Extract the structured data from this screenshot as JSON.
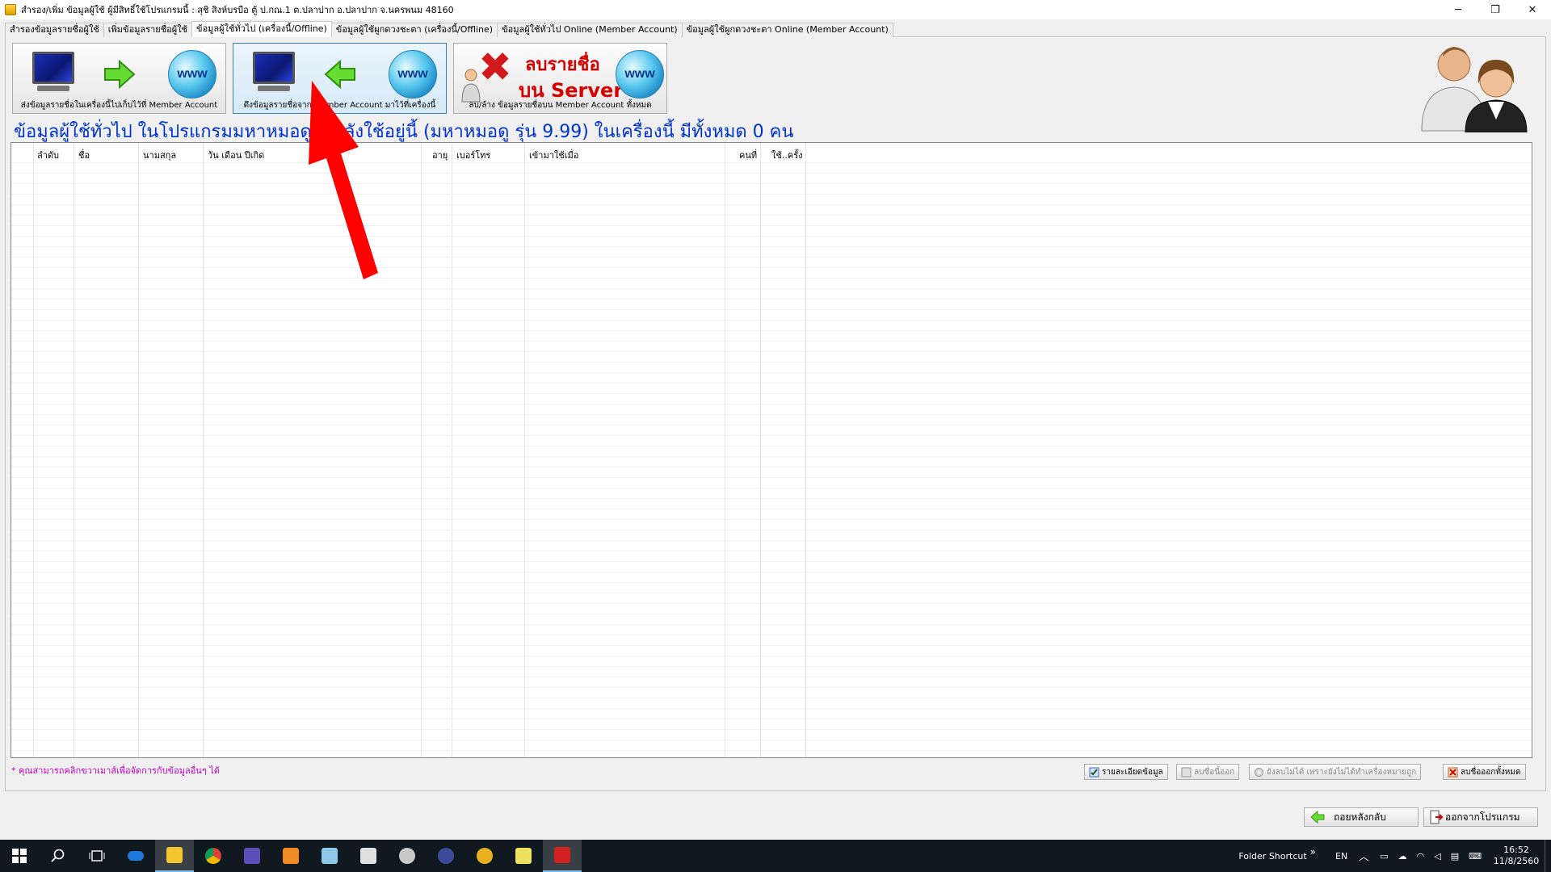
{
  "window": {
    "title": "สำรอง/เพิ่ม ข้อมูลผู้ใช้ ผู้มีสิทธิ์ใช้โปรแกรมนี้ : สุชิ  สิงห์บรบือ    ตู้ ป.กณ.1 ต.ปลาปาก อ.ปลาปาก จ.นครพนม 48160",
    "minimize": "─",
    "restore": "❐",
    "close": "✕"
  },
  "tabs": [
    {
      "label": "สำรองข้อมูลรายชื่อผู้ใช้"
    },
    {
      "label": "เพิ่มข้อมูลรายชื่อผู้ใช้"
    },
    {
      "label": "ข้อมูลผู้ใช้ทั่วไป (เครื่องนี้/Offline)"
    },
    {
      "label": "ข้อมูลผู้ใช้ผูกดวงชะตา (เครื่องนี้/Offline)"
    },
    {
      "label": "ข้อมูลผู้ใช้ทั่วไป Online (Member Account)"
    },
    {
      "label": "ข้อมูลผู้ใช้ผูกดวงชะตา Online (Member Account)"
    }
  ],
  "active_tab": 2,
  "actions": {
    "send": {
      "caption": "ส่งข้อมูลรายชื่อในเครื่องนี้ไปเก็บไว้ที่ Member Account"
    },
    "fetch": {
      "caption": "ดึงข้อมูลรายชื่อจาก Member Account มาไว้ที่เครื่องนี้"
    },
    "delete": {
      "caption": "ลบ/ล้าง ข้อมูลรายชื่อบน Member Account ทั้งหมด",
      "line1": "ลบรายชื่อ",
      "line2": "บน Server"
    },
    "www": "www"
  },
  "heading": "ข้อมูลผู้ใช้ทั่วไป ในโปรแกรมมหาหมอดูที่กำลังใช้อยู่นี้ (มหาหมอดู รุ่น 9.99) ในเครื่องนี้ มีทั้งหมด 0 คน",
  "grid": {
    "columns": [
      "ลำดับ",
      "ชื่อ",
      "นามสกุล",
      "วัน เดือน ปีเกิด",
      "อายุ",
      "เบอร์โทร",
      "เข้ามาใช้เมื่อ",
      "คนที่",
      "ใช้..ครั้ง"
    ],
    "rows": []
  },
  "note": "* คุณสามารถคลิกขวาเมาส์เพื่อจัดการกับข้อมูลอื่นๆ ได้",
  "small_buttons": {
    "details": "รายละเอียดข้อมูล",
    "delete_one": "ลบชื่อนี้ออก",
    "cannot_delete": "ยังลบไม่ได้ เพราะยังไม่ได้ทำเครื่องหมายถูก",
    "delete_all": "ลบชื่อออกทั้งหมด"
  },
  "bottom_buttons": {
    "back": "ถอยหลังกลับ",
    "exit": "ออกจากโปรแกรม"
  },
  "taskbar": {
    "folder_shortcut": "Folder Shortcut",
    "chevron": "»",
    "lang": "EN",
    "time": "16:52",
    "date": "11/8/2560"
  },
  "colors": {
    "heading": "#0033cc",
    "note": "#c000c0",
    "pointer": "#ff0000"
  }
}
